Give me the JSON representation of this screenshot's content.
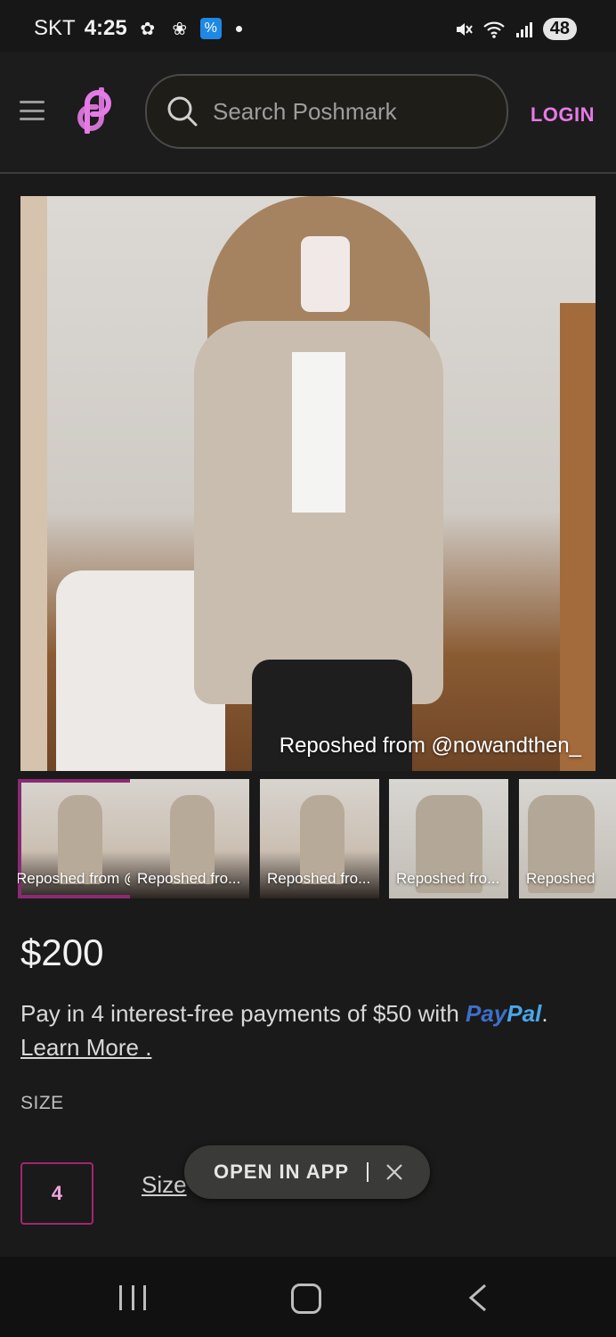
{
  "status_bar": {
    "carrier": "SKT",
    "time": "4:25",
    "battery": "48",
    "icons": [
      "leaf-icon",
      "pinwheel-icon",
      "percent-app-icon",
      "notification-dot",
      "mute-icon",
      "wifi-icon",
      "signal-icon",
      "battery-icon"
    ]
  },
  "header": {
    "search_placeholder": "Search Poshmark",
    "login_label": "LOGIN",
    "accent_color": "#e57be6"
  },
  "listing": {
    "main_image_caption": "Reposhed from @nowandthen_",
    "thumbnails": [
      {
        "caption": "Reposhed from @nowandthen_"
      },
      {
        "caption": "Reposhed fro..."
      },
      {
        "caption": "Reposhed fro..."
      },
      {
        "caption": "Reposhed fro..."
      },
      {
        "caption": "Reposhed"
      }
    ],
    "price": "$200",
    "paypal_text": "Pay in 4 interest-free payments of $50 with ",
    "paypal_brand_1": "Pay",
    "paypal_brand_2": "Pal",
    "paypal_period": ".",
    "learn_more": "Learn More",
    "learn_more_after": ".",
    "size_label": "SIZE",
    "size_value": "4",
    "size_chart_link": "Size"
  },
  "open_app": {
    "label": "OPEN IN APP"
  }
}
